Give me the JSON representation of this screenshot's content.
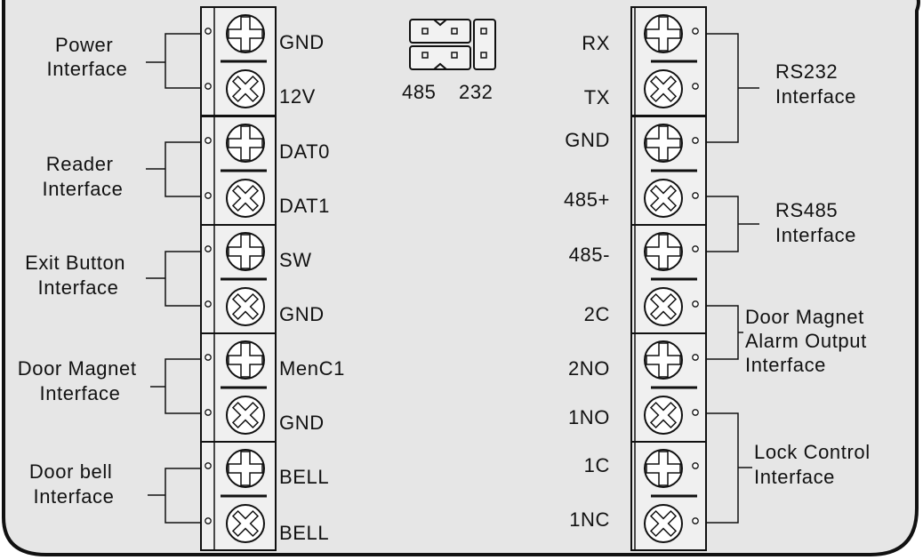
{
  "jumper": {
    "labels": [
      "485",
      "232"
    ]
  },
  "left_block": {
    "terminals": [
      "GND",
      "12V",
      "DAT0",
      "DAT1",
      "SW",
      "GND",
      "MenC1",
      "GND",
      "BELL",
      "BELL"
    ],
    "interfaces": [
      {
        "lines": [
          "Power",
          "Interface"
        ]
      },
      {
        "lines": [
          "Reader",
          "Interface"
        ]
      },
      {
        "lines": [
          "Exit Button",
          "Interface"
        ]
      },
      {
        "lines": [
          "Door Magnet",
          "Interface"
        ]
      },
      {
        "lines": [
          "Door bell",
          "Interface"
        ]
      }
    ]
  },
  "right_block": {
    "terminals": [
      "RX",
      "TX",
      "GND",
      "485+",
      "485-",
      "2C",
      "2NO",
      "1NO",
      "1C",
      "1NC"
    ],
    "interfaces": [
      {
        "lines": [
          "RS232",
          "Interface"
        ]
      },
      {
        "lines": [
          "RS485",
          "Interface"
        ]
      },
      {
        "lines": [
          "Door Magnet",
          "Alarm Output",
          "Interface"
        ]
      },
      {
        "lines": [
          "Lock Control",
          "Interface"
        ]
      }
    ]
  }
}
